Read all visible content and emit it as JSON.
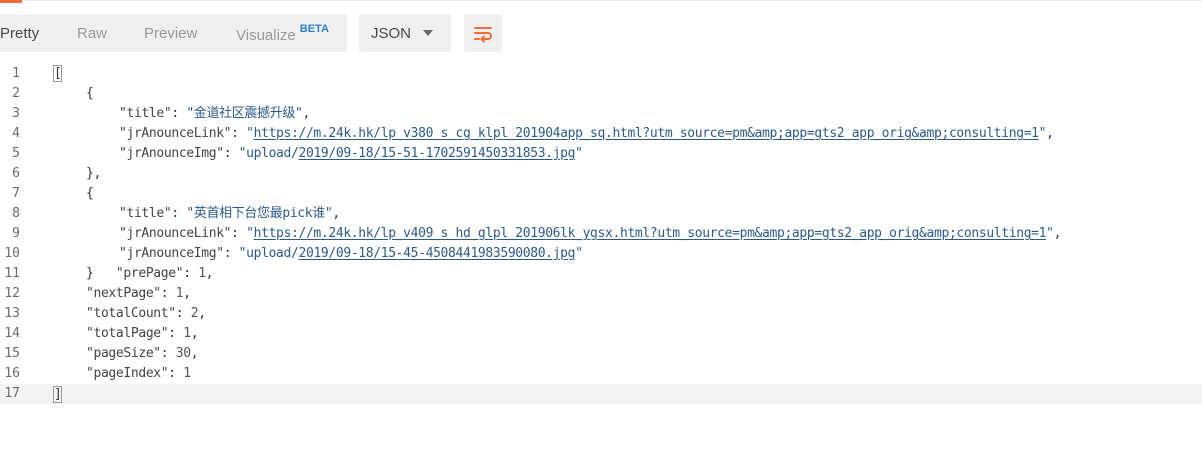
{
  "toolbar": {
    "modes": [
      {
        "label": "Pretty"
      },
      {
        "label": "Raw"
      },
      {
        "label": "Preview"
      },
      {
        "label": "Visualize",
        "badge": "BETA"
      }
    ],
    "format": "JSON",
    "wrap_icon": "wrap-lines-icon",
    "accent_color": "#f26b3a"
  },
  "editor": {
    "line_numbers": [
      "1",
      "2",
      "3",
      "4",
      "5",
      "6",
      "7",
      "8",
      "9",
      "10",
      "11",
      "12",
      "13",
      "14",
      "15",
      "16",
      "17"
    ],
    "items": [
      {
        "title": "金道社区震撼升级",
        "jrAnounceLink": "https://m.24k.hk/lp_v380_s_cg_klpl_201904app_sq.html?utm_source=pm&amp;app=gts2_app_orig&amp;consulting=1",
        "jrAnounceImg_prefix": "upload/",
        "jrAnounceImg_path": "2019/09-18/15-51-1702591450331853.jpg"
      },
      {
        "title": "英首相下台您最pick谁",
        "jrAnounceLink": "https://m.24k.hk/lp_v409_s_hd_glpl_201906lk_ygsx.html?utm_source=pm&amp;app=gts2_app_orig&amp;consulting=1",
        "jrAnounceImg_prefix": "upload/",
        "jrAnounceImg_path": "2019/09-18/15-45-4508441983590080.jpg"
      }
    ],
    "fields": {
      "prePage": "1",
      "nextPage": "1",
      "totalCount": "2",
      "totalPage": "1",
      "pageSize": "30",
      "pageIndex": "1"
    }
  }
}
